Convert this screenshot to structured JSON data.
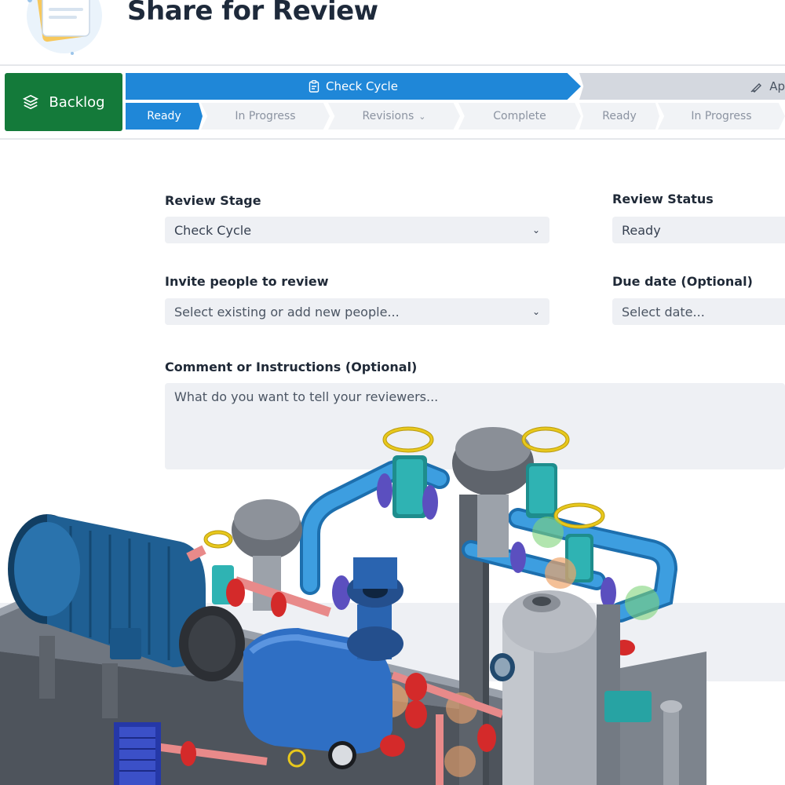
{
  "header": {
    "title": "Share for Review"
  },
  "workflow": {
    "backlog_label": "Backlog",
    "stages": [
      {
        "label": "Check Cycle",
        "icon": "clipboard-icon"
      },
      {
        "label": "Ap",
        "icon": "pen-icon"
      }
    ],
    "steps": [
      {
        "label": "Ready",
        "active": true
      },
      {
        "label": "In Progress",
        "active": false
      },
      {
        "label": "Revisions",
        "active": false,
        "has_dropdown": true
      },
      {
        "label": "Complete",
        "active": false
      },
      {
        "label": "Ready",
        "active": false
      },
      {
        "label": "In Progress",
        "active": false
      }
    ]
  },
  "form": {
    "review_stage": {
      "label": "Review Stage",
      "value": "Check Cycle"
    },
    "review_status": {
      "label": "Review Status",
      "value": "Ready"
    },
    "invite": {
      "label": "Invite people to review",
      "placeholder": "Select existing or add new people..."
    },
    "due_date": {
      "label": "Due date (Optional)",
      "placeholder": "Select date..."
    },
    "comment": {
      "label": "Comment or Instructions (Optional)",
      "placeholder": "What do you want to tell your reviewers..."
    }
  },
  "colors": {
    "backlog_green": "#147a3a",
    "active_blue": "#1f87d8",
    "field_bg": "#eef0f4",
    "pipe_blue": "#3d9ee0",
    "motor_blue": "#1f5f93",
    "valve_teal": "#27a3a3",
    "flange_red": "#d42a2a",
    "handwheel_yellow": "#e8c81c"
  }
}
